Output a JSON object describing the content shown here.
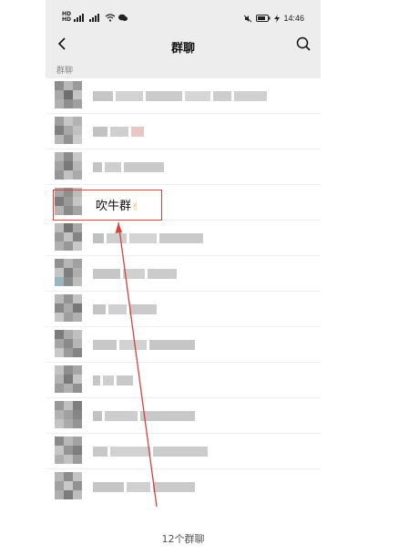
{
  "status_bar": {
    "time": "14:46",
    "left_label": "HD"
  },
  "nav": {
    "title": "群聊"
  },
  "section": {
    "label": "群聊"
  },
  "highlighted_group": {
    "name": "吹牛群",
    "emoji": "✌"
  },
  "footer": {
    "count_text": "12个群聊"
  },
  "colors": {
    "header_bg": "#ededed",
    "annotation_red": "#d9403a",
    "blur_gray": "#c8c8c8"
  }
}
